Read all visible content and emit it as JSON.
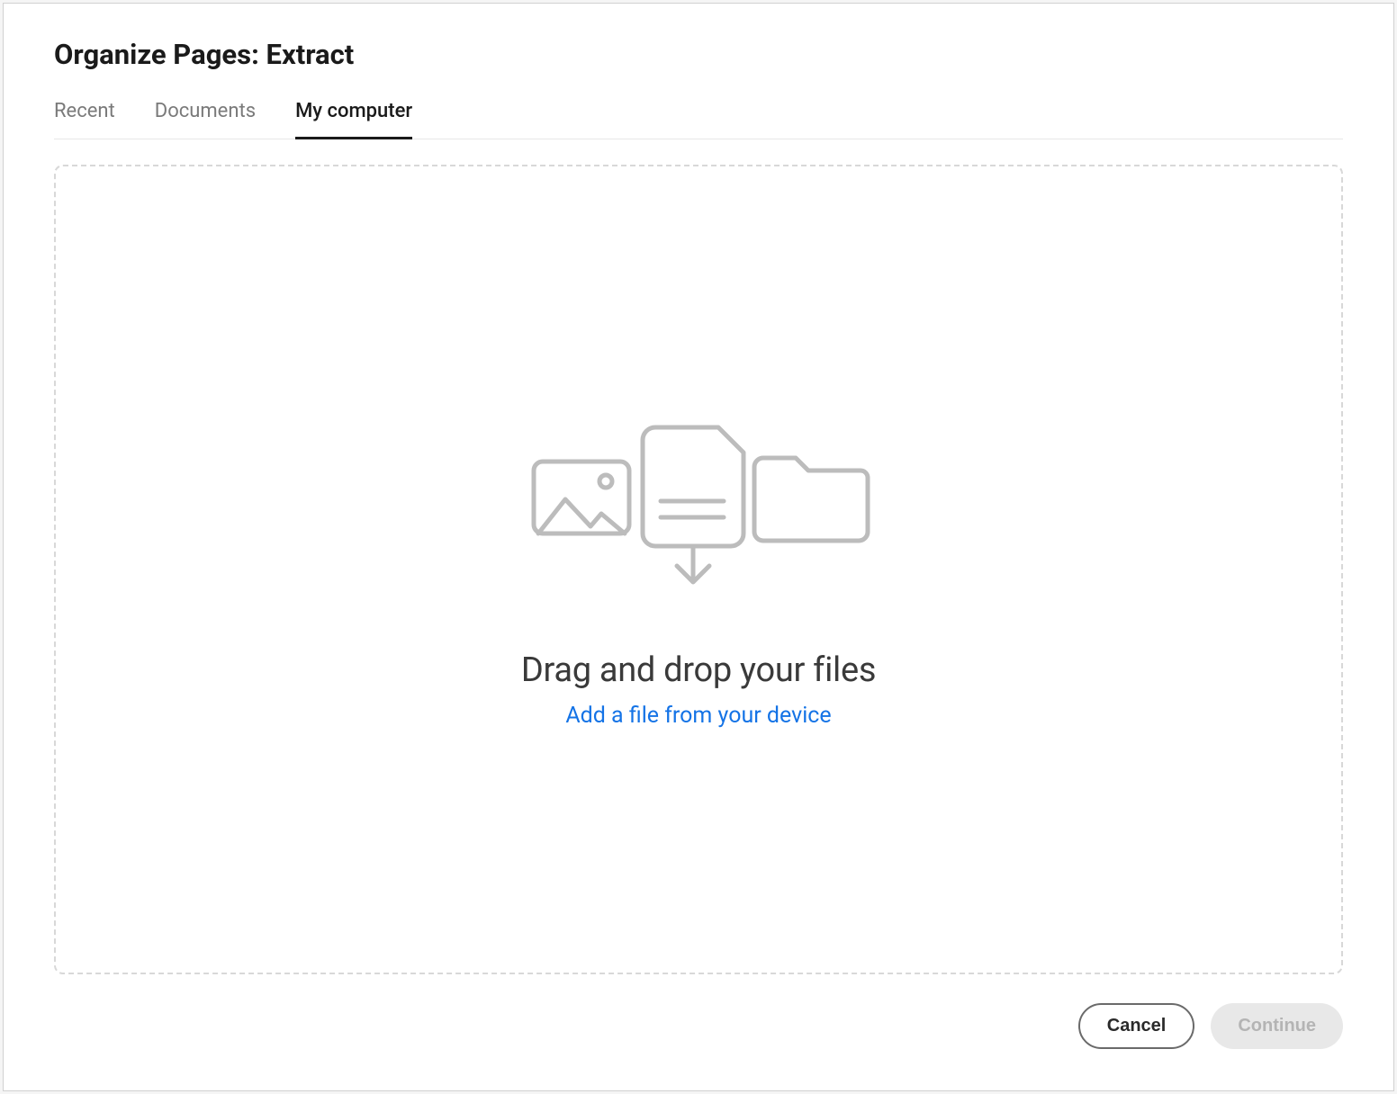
{
  "dialog": {
    "title": "Organize Pages: Extract"
  },
  "tabs": [
    {
      "label": "Recent",
      "active": false
    },
    {
      "label": "Documents",
      "active": false
    },
    {
      "label": "My computer",
      "active": true
    }
  ],
  "dropzone": {
    "heading": "Drag and drop your files",
    "link": "Add a file from your device"
  },
  "footer": {
    "cancel": "Cancel",
    "continue": "Continue"
  }
}
